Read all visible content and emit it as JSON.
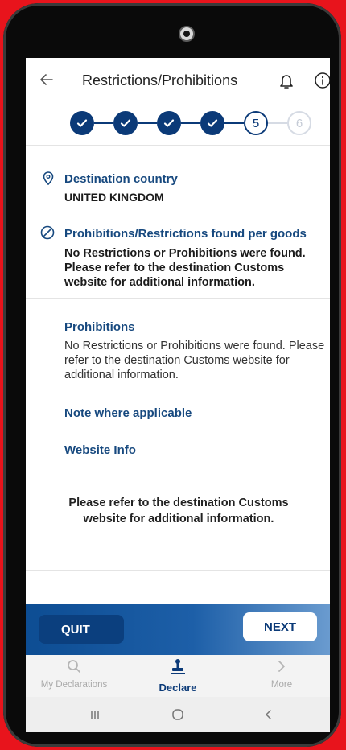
{
  "header": {
    "title": "Restrictions/Prohibitions"
  },
  "stepper": {
    "steps": [
      {
        "state": "done",
        "label": ""
      },
      {
        "state": "done",
        "label": ""
      },
      {
        "state": "done",
        "label": ""
      },
      {
        "state": "done",
        "label": ""
      },
      {
        "state": "active",
        "label": "5"
      },
      {
        "state": "future",
        "label": "6"
      }
    ]
  },
  "destination": {
    "label": "Destination country",
    "value": "UNITED KINGDOM"
  },
  "found": {
    "label": "Prohibitions/Restrictions found per goods",
    "text": "No Restrictions or Prohibitions were found. Please refer to the destination Customs website for additional information."
  },
  "prohibitions": {
    "label": "Prohibitions",
    "text": "No Restrictions or Prohibitions were found. Please refer to the destination Customs website for additional information."
  },
  "note_label": "Note where applicable",
  "website_label": "Website Info",
  "footer_note": "Please refer to the destination Customs website for additional information.",
  "actions": {
    "quit": "QUIT",
    "next": "NEXT"
  },
  "bottom_nav": [
    {
      "label": "My Declarations",
      "icon": "search-icon"
    },
    {
      "label": "Declare",
      "icon": "stamp-icon"
    },
    {
      "label": "More",
      "icon": "chevron-right-icon"
    }
  ],
  "colors": {
    "primary": "#0b3a78",
    "link": "#17497f",
    "frame": "#e8141c"
  }
}
